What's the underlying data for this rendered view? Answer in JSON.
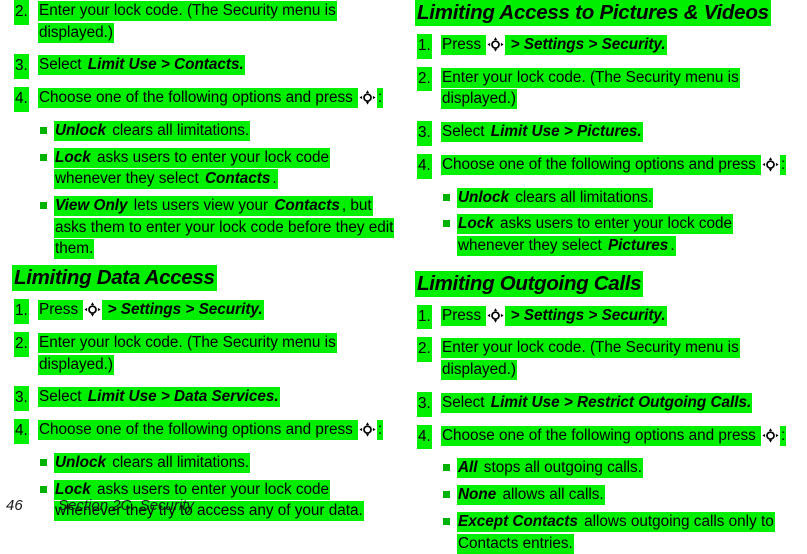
{
  "document": {
    "footer": {
      "page_number": "46",
      "section": "Section 2C. Security"
    }
  },
  "icons": {
    "nav_key": "navigation-key-icon"
  },
  "colors": {
    "highlight": "#00ef00",
    "bullet": "#00b200",
    "text": "#000000",
    "background": "#ffffff"
  },
  "left_column": {
    "continued_steps": [
      {
        "number": "2.",
        "parts": [
          {
            "text": "Enter your lock code. (The Security menu is displayed.)"
          }
        ]
      },
      {
        "number": "3.",
        "parts": [
          {
            "text": "Select "
          },
          {
            "text": "Limit Use > Contacts.",
            "style": "bold-italic"
          }
        ]
      },
      {
        "number": "4.",
        "parts": [
          {
            "text": "Choose one of the following options and press "
          },
          {
            "icon": "navigation-key-icon"
          },
          {
            "text": ":"
          }
        ]
      }
    ],
    "continued_bullets": [
      {
        "parts": [
          {
            "text": "Unlock",
            "style": "bold-italic"
          },
          {
            "text": " clears all limitations."
          }
        ]
      },
      {
        "parts": [
          {
            "text": "Lock",
            "style": "bold-italic"
          },
          {
            "text": " asks users to enter your lock code whenever they select "
          },
          {
            "text": "Contacts",
            "style": "bold-italic"
          },
          {
            "text": "."
          }
        ]
      },
      {
        "parts": [
          {
            "text": "View Only",
            "style": "bold-italic"
          },
          {
            "text": " lets users view your "
          },
          {
            "text": "Contacts",
            "style": "bold-italic"
          },
          {
            "text": ", but asks them to enter your lock code before they edit them."
          }
        ]
      }
    ],
    "section": {
      "heading": "Limiting Data Access",
      "steps": [
        {
          "number": "1.",
          "parts": [
            {
              "text": "Press "
            },
            {
              "icon": "navigation-key-icon"
            },
            {
              "text": " > Settings > Security.",
              "style": "bold-italic"
            }
          ]
        },
        {
          "number": "2.",
          "parts": [
            {
              "text": "Enter your lock code. (The Security menu is displayed.)"
            }
          ]
        },
        {
          "number": "3.",
          "parts": [
            {
              "text": "Select "
            },
            {
              "text": "Limit Use > Data Services.",
              "style": "bold-italic"
            }
          ]
        },
        {
          "number": "4.",
          "parts": [
            {
              "text": "Choose one of the following options and press "
            },
            {
              "icon": "navigation-key-icon"
            },
            {
              "text": ":"
            }
          ]
        }
      ],
      "bullets": [
        {
          "parts": [
            {
              "text": "Unlock",
              "style": "bold-italic"
            },
            {
              "text": " clears all limitations."
            }
          ]
        },
        {
          "parts": [
            {
              "text": "Lock",
              "style": "bold-italic"
            },
            {
              "text": " asks users to enter your lock code whenever they try to access any of your data."
            }
          ]
        }
      ]
    }
  },
  "right_column": {
    "section_one": {
      "heading": "Limiting Access to Pictures & Videos",
      "steps": [
        {
          "number": "1.",
          "parts": [
            {
              "text": "Press "
            },
            {
              "icon": "navigation-key-icon"
            },
            {
              "text": " > Settings > Security.",
              "style": "bold-italic"
            }
          ]
        },
        {
          "number": "2.",
          "parts": [
            {
              "text": "Enter your lock code. (The Security menu is displayed.)"
            }
          ]
        },
        {
          "number": "3.",
          "parts": [
            {
              "text": "Select "
            },
            {
              "text": "Limit Use > Pictures.",
              "style": "bold-italic"
            }
          ]
        },
        {
          "number": "4.",
          "parts": [
            {
              "text": "Choose one of the following options and press "
            },
            {
              "icon": "navigation-key-icon"
            },
            {
              "text": ":"
            }
          ]
        }
      ],
      "bullets": [
        {
          "parts": [
            {
              "text": "Unlock",
              "style": "bold-italic"
            },
            {
              "text": " clears all limitations."
            }
          ]
        },
        {
          "parts": [
            {
              "text": "Lock",
              "style": "bold-italic"
            },
            {
              "text": " asks users to enter your lock code whenever they select "
            },
            {
              "text": "Pictures",
              "style": "bold-italic"
            },
            {
              "text": "."
            }
          ]
        }
      ]
    },
    "section_two": {
      "heading": "Limiting Outgoing Calls",
      "steps": [
        {
          "number": "1.",
          "parts": [
            {
              "text": "Press "
            },
            {
              "icon": "navigation-key-icon"
            },
            {
              "text": " > Settings > Security.",
              "style": "bold-italic"
            }
          ]
        },
        {
          "number": "2.",
          "parts": [
            {
              "text": "Enter your lock code. (The Security menu is displayed.)"
            }
          ]
        },
        {
          "number": "3.",
          "parts": [
            {
              "text": "Select "
            },
            {
              "text": "Limit Use > Restrict Outgoing Calls.",
              "style": "bold-italic"
            }
          ]
        },
        {
          "number": "4.",
          "parts": [
            {
              "text": "Choose one of the following options and press "
            },
            {
              "icon": "navigation-key-icon"
            },
            {
              "text": ":"
            }
          ]
        }
      ],
      "bullets": [
        {
          "parts": [
            {
              "text": "All",
              "style": "bold-italic"
            },
            {
              "text": " stops all outgoing calls."
            }
          ]
        },
        {
          "parts": [
            {
              "text": "None",
              "style": "bold-italic"
            },
            {
              "text": " allows all calls."
            }
          ]
        },
        {
          "parts": [
            {
              "text": "Except Contacts",
              "style": "bold-italic"
            },
            {
              "text": " allows outgoing calls only to Contacts entries."
            }
          ]
        }
      ]
    }
  },
  "text_values": {
    "heading_limiting_data_access": "Limiting Data Access",
    "heading_limiting_pictures": "Limiting Access to Pictures & Videos",
    "heading_limiting_outgoing": "Limiting Outgoing Calls"
  }
}
